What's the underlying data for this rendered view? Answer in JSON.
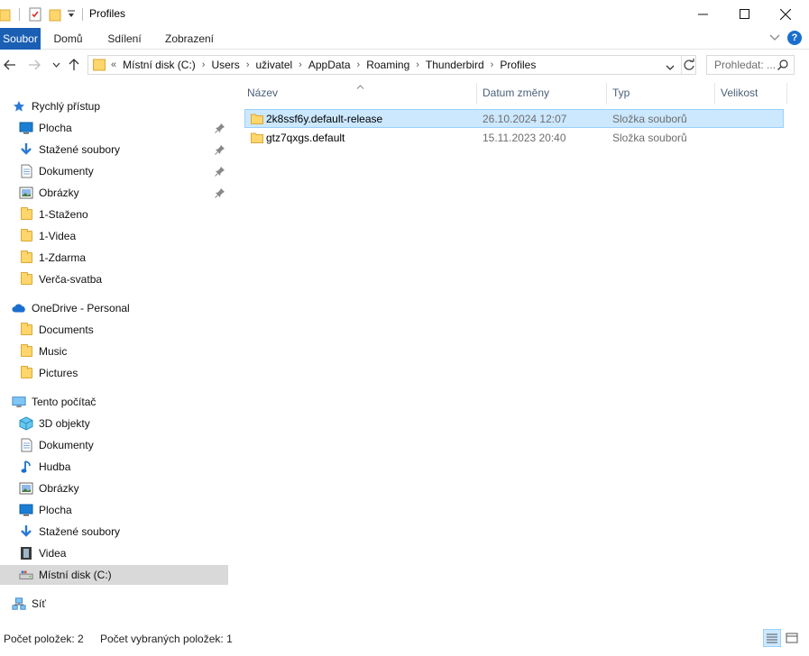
{
  "window": {
    "title": "Profiles"
  },
  "ribbon": {
    "tabs": [
      "Soubor",
      "Domů",
      "Sdílení",
      "Zobrazení"
    ]
  },
  "address": {
    "overflow": "«",
    "crumbs": [
      "Místní disk (C:)",
      "Users",
      "uživatel",
      "AppData",
      "Roaming",
      "Thunderbird",
      "Profiles"
    ]
  },
  "search": {
    "placeholder": "Prohledat: ..."
  },
  "nav": {
    "items": [
      {
        "label": "Rychlý přístup",
        "icon": "star-icon"
      },
      {
        "label": "Plocha",
        "icon": "desktop-icon",
        "pinned": true
      },
      {
        "label": "Stažené soubory",
        "icon": "download-icon",
        "pinned": true
      },
      {
        "label": "Dokumenty",
        "icon": "document-icon",
        "pinned": true
      },
      {
        "label": "Obrázky",
        "icon": "pictures-icon",
        "pinned": true
      },
      {
        "label": "1-Staženo",
        "icon": "folder-icon"
      },
      {
        "label": "1-Videa",
        "icon": "folder-icon"
      },
      {
        "label": "1-Zdarma",
        "icon": "folder-icon"
      },
      {
        "label": "Verča-svatba",
        "icon": "folder-icon"
      },
      {
        "label": "OneDrive - Personal",
        "icon": "cloud-icon"
      },
      {
        "label": "Documents",
        "icon": "folder-icon"
      },
      {
        "label": "Music",
        "icon": "folder-icon"
      },
      {
        "label": "Pictures",
        "icon": "folder-icon"
      },
      {
        "label": "Tento počítač",
        "icon": "computer-icon"
      },
      {
        "label": "3D objekty",
        "icon": "cube-icon"
      },
      {
        "label": "Dokumenty",
        "icon": "document-icon"
      },
      {
        "label": "Hudba",
        "icon": "music-note-icon"
      },
      {
        "label": "Obrázky",
        "icon": "pictures-icon"
      },
      {
        "label": "Plocha",
        "icon": "desktop-icon"
      },
      {
        "label": "Stažené soubory",
        "icon": "download-icon"
      },
      {
        "label": "Videa",
        "icon": "film-icon"
      },
      {
        "label": "Místní disk (C:)",
        "icon": "drive-icon",
        "selected": true
      },
      {
        "label": "Síť",
        "icon": "network-icon"
      }
    ]
  },
  "columns": {
    "name": "Název",
    "date": "Datum změny",
    "type": "Typ",
    "size": "Velikost"
  },
  "files": [
    {
      "name": "2k8ssf6y.default-release",
      "date": "26.10.2024 12:07",
      "type": "Složka souborů",
      "size": "",
      "selected": true
    },
    {
      "name": "gtz7qxgs.default",
      "date": "15.11.2023 20:40",
      "type": "Složka souborů",
      "size": "",
      "selected": false
    }
  ],
  "status": {
    "count": "Počet položek: 2",
    "selected": "Počet vybraných položek: 1"
  },
  "colors": {
    "accent": "#1a5fb4",
    "selection": "#cce8ff",
    "selection_border": "#99d1ff",
    "folder": "#ffd66b"
  }
}
